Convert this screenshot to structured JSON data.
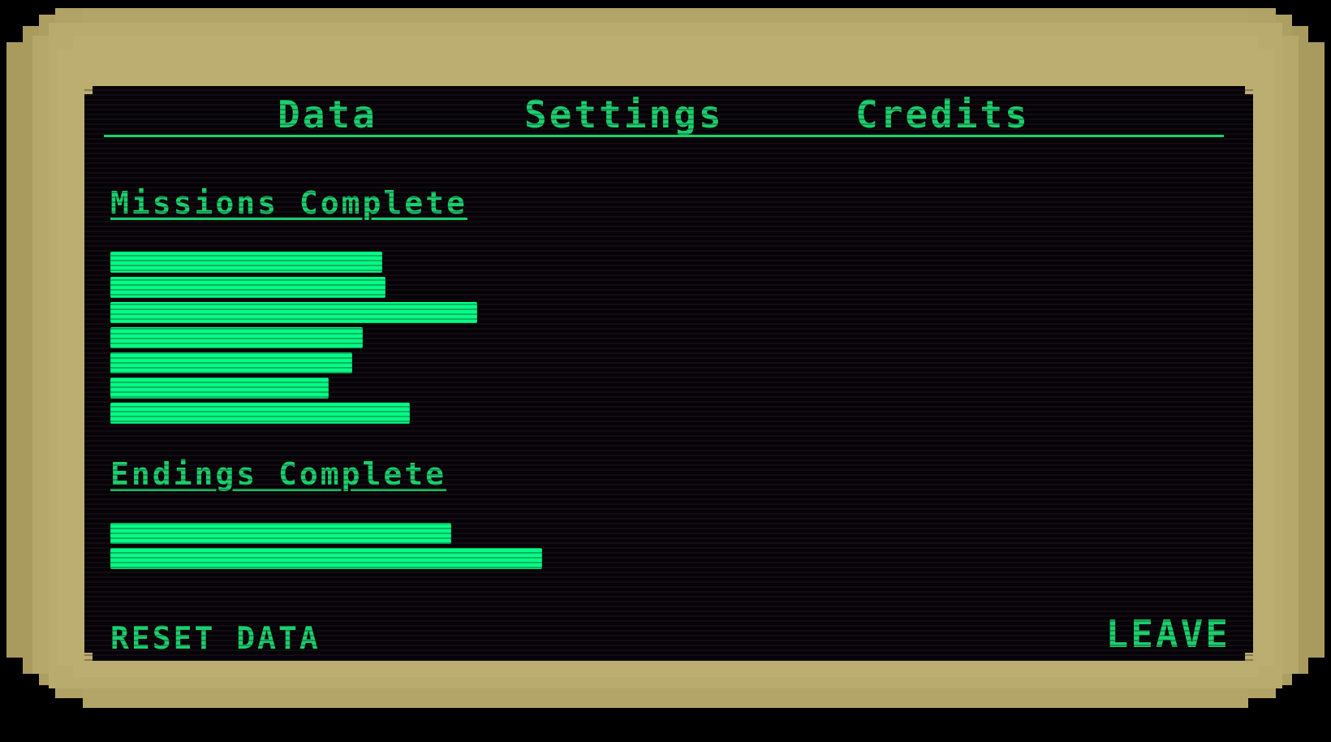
{
  "tabs": {
    "data": "Data",
    "settings": "Settings",
    "credits": "Credits",
    "active": "Data"
  },
  "missions": {
    "title": "Missions Complete",
    "bars": [
      0.335,
      0.339,
      0.452,
      0.311,
      0.298,
      0.269,
      0.369
    ]
  },
  "endings": {
    "title": "Endings Complete",
    "bars": [
      0.42,
      0.532
    ]
  },
  "buttons": {
    "reset": "RESET DATA",
    "leave": "LEAVE"
  },
  "colors": {
    "text": "#18d16c",
    "bar": "#00ff84",
    "screen": "#050306",
    "frame": "#b3a468"
  }
}
